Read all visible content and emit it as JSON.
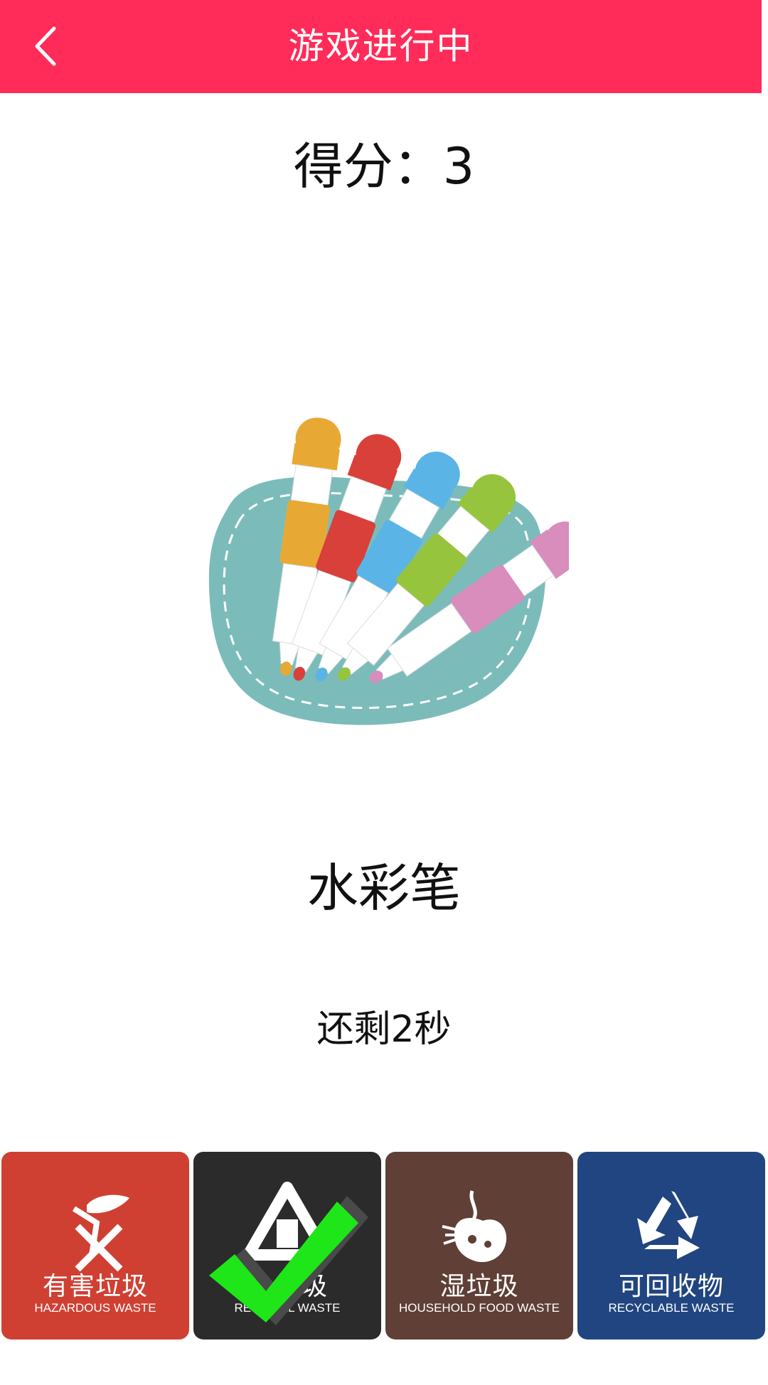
{
  "header": {
    "title": "游戏进行中",
    "back_icon": "chevron-left-icon"
  },
  "game": {
    "score_text": "得分：3",
    "item_name": "水彩笔",
    "item_image": "watercolor-pens-illustration",
    "timer_text": "还剩2秒"
  },
  "bins": [
    {
      "cn": "有害垃圾",
      "en": "HAZARDOUS WASTE",
      "icon": "hazardous-icon",
      "color": "#cf4033"
    },
    {
      "cn": "垃圾",
      "en": "RESIDUAL WASTE",
      "icon": "residual-icon",
      "color": "#2b2b2b"
    },
    {
      "cn": "湿垃圾",
      "en": "HOUSEHOLD FOOD WASTE",
      "icon": "food-waste-icon",
      "color": "#5f3f36"
    },
    {
      "cn": "可回收物",
      "en": "RECYCLABLE WASTE",
      "icon": "recycle-icon",
      "color": "#214581"
    }
  ],
  "selection": {
    "icon": "green-checkmark-icon",
    "color": "#1ee619"
  },
  "colors": {
    "accent": "#ff2b58"
  }
}
